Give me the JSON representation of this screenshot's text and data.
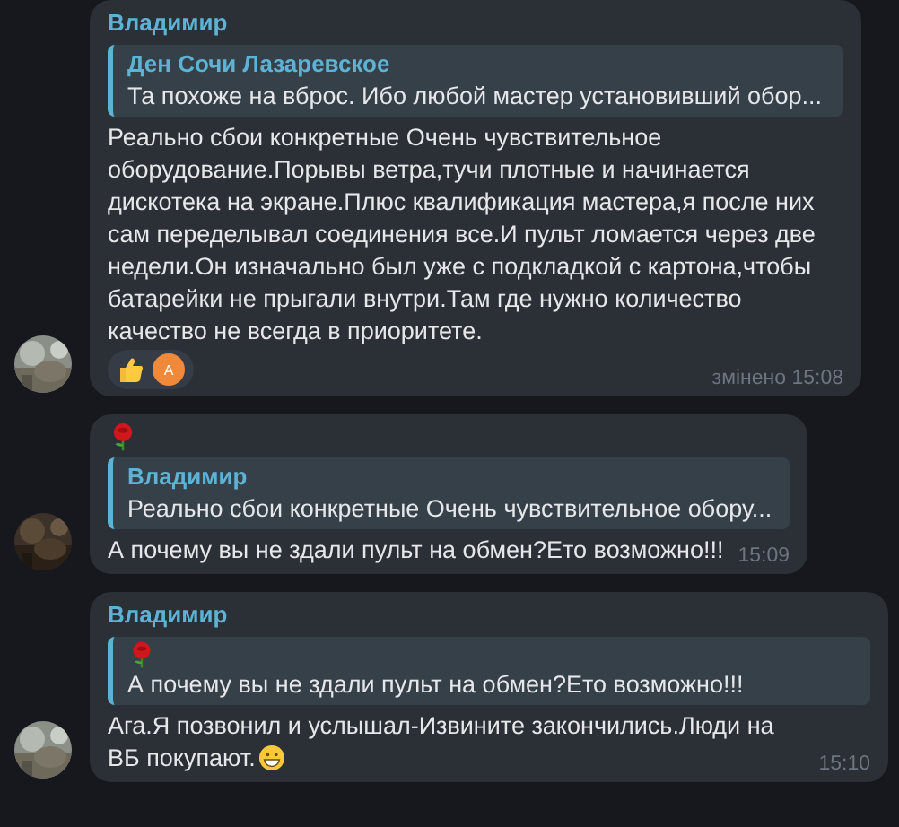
{
  "messages": [
    {
      "sender": "Владимир",
      "blocks": [
        {
          "kind": "reply",
          "author": "Ден Сочи Лазаревское",
          "text": "Та похоже на вброс. Ибо любой мастер установивший обор..."
        },
        {
          "kind": "text",
          "text": "Реально сбои конкретные Очень чувствительное оборудование.Порывы ветра,тучи плотные и начинается дискотека на экране.Плюс квалификация мастера,я после них сам переделывал соединения все.И пульт ломается через две недели.Он изначально был уже с подкладкой с картона,чтобы батарейки не прыгали внутри.Там где нужно количество качество не всегда в приоритете."
        }
      ],
      "reactions": [
        {
          "kind": "thumbs-up"
        },
        {
          "kind": "avatar",
          "label": "A"
        }
      ],
      "time": "змінено 15:08"
    },
    {
      "blocks": [
        {
          "kind": "rose"
        },
        {
          "kind": "reply",
          "author": "Владимир",
          "text": "Реально сбои конкретные Очень чувствительное обору..."
        },
        {
          "kind": "text",
          "text": "А почему вы не здали пульт на обмен?Ето возможно!!!"
        }
      ],
      "time": "15:09"
    },
    {
      "sender": "Владимир",
      "blocks": [
        {
          "kind": "reply",
          "rose": true,
          "text": "А почему вы не здали пульт на обмен?Ето возможно!!!"
        },
        {
          "kind": "text",
          "text": "Ага.Я позвонил и услышал-Извините закончились.Люди на ВБ покупают.",
          "trailing": {
            "kind": "grin"
          }
        }
      ],
      "time": "15:10"
    }
  ]
}
